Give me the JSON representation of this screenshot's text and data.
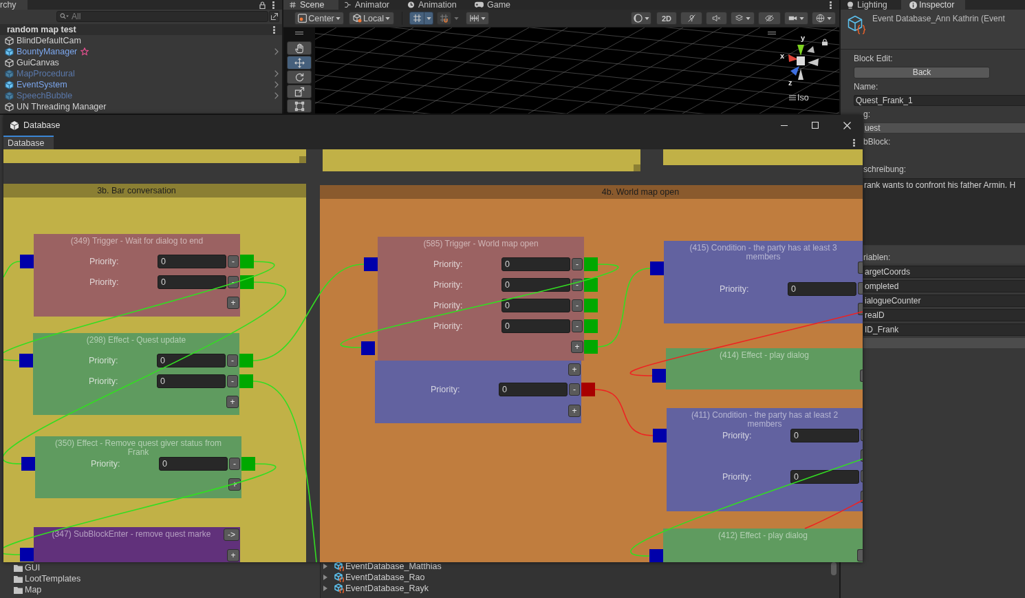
{
  "hierarchy": {
    "tab": "rchy",
    "search": {
      "placeholder": "All"
    },
    "scene": "random map test",
    "items": [
      {
        "label": "BlindDefaultCam",
        "prefab": false,
        "active": true,
        "starred": false
      },
      {
        "label": "BountyManager",
        "prefab": true,
        "active": true,
        "starred": true
      },
      {
        "label": "GuiCanvas",
        "prefab": false,
        "active": true,
        "starred": false
      },
      {
        "label": "MapProcedural",
        "prefab": true,
        "active": false,
        "starred": false
      },
      {
        "label": "EventSystem",
        "prefab": true,
        "active": true,
        "starred": false
      },
      {
        "label": "SpeechBubble",
        "prefab": true,
        "active": false,
        "starred": false
      },
      {
        "label": "UN Threading Manager",
        "prefab": false,
        "active": true,
        "starred": false
      }
    ]
  },
  "scene_view": {
    "tabs": [
      {
        "label": "Scene",
        "selected": true
      },
      {
        "label": "Animator",
        "selected": false
      },
      {
        "label": "Animation",
        "selected": false
      },
      {
        "label": "Game",
        "selected": false
      }
    ],
    "toolbar": {
      "pivot": "Center",
      "space": "Local",
      "grid_snap": {
        "on": true
      },
      "view_2d": {
        "label": "2D",
        "on": false
      }
    },
    "tools": [
      {
        "selected": false
      },
      {
        "selected": true
      },
      {
        "selected": false
      },
      {
        "selected": false
      },
      {
        "selected": false
      }
    ],
    "gizmo": {
      "axes": [
        "y",
        "x",
        "z"
      ],
      "projection": "Iso"
    }
  },
  "inspector": {
    "tabs": [
      {
        "label": "Lighting",
        "selected": false
      },
      {
        "label": "Inspector",
        "selected": true
      }
    ],
    "title": "Event Database_Ann Kathrin (Event",
    "block_edit_label": "Block Edit:",
    "back_button": "Back",
    "name_label": "Name:",
    "name_value": "Quest_Frank_1",
    "tag_label": "g:",
    "tag_value": "uest",
    "subblock_label": "bBlock:",
    "description_label": "schreibung:",
    "description": "rank wants to confront his father Armin. H",
    "variables_label": "riablen:",
    "variables": [
      "argetCoords",
      "ompleted",
      "ialogueCounter",
      "realD",
      "ID_Frank"
    ]
  },
  "database_window": {
    "title": "Database",
    "tabs": [
      {
        "label": "Database",
        "selected": true
      }
    ],
    "groups": [
      {
        "color": "#c1b147"
      },
      {
        "color": "#c1b147"
      },
      {
        "color": "#c1b147"
      },
      {
        "title": "3b. Bar conversation",
        "color": "#c1b147",
        "nodes": [
          {
            "title": "(349) Trigger - Wait for dialog to end",
            "kind": "trigger",
            "items": [
              {
                "kind": "row",
                "label": "Priority:",
                "value": "0",
                "remove": "-",
                "color": "#00a800"
              },
              {
                "kind": "row",
                "label": "Priority:",
                "value": "0",
                "remove": "-",
                "color": "#00a800"
              },
              {
                "kind": "add",
                "label": "+"
              }
            ]
          },
          {
            "title": "(298) Effect - Quest update",
            "kind": "effect",
            "items": [
              {
                "kind": "row",
                "label": "Priority:",
                "value": "0",
                "remove": "-",
                "color": "#00a800"
              },
              {
                "kind": "row",
                "label": "Priority:",
                "value": "0",
                "remove": "-",
                "color": "#00a800"
              },
              {
                "kind": "add",
                "label": "+"
              }
            ]
          },
          {
            "title": "(350) Effect - Remove quest giver status from Frank",
            "kind": "effect",
            "items": [
              {
                "kind": "row",
                "label": "Priority:",
                "value": "0",
                "remove": "-",
                "color": "#00a800"
              },
              {
                "kind": "add",
                "label": "+"
              }
            ]
          },
          {
            "title": "(347) SubBlockEnter - remove quest marke",
            "kind": "subblock",
            "enter_button": "->",
            "items": [
              {
                "kind": "add",
                "label": "+"
              }
            ]
          }
        ]
      },
      {
        "title": "4b. World map open",
        "color": "#c07d3e",
        "nodes": [
          {
            "title": "(585) Trigger - World map open",
            "kind": "trigger",
            "items": [
              {
                "kind": "row",
                "label": "Priority:",
                "value": "0",
                "remove": "-",
                "color": "#00a800"
              },
              {
                "kind": "row",
                "label": "Priority:",
                "value": "0",
                "remove": "-",
                "color": "#00a800"
              },
              {
                "kind": "row",
                "label": "Priority:",
                "value": "0",
                "remove": "-",
                "color": "#00a800"
              },
              {
                "kind": "row",
                "label": "Priority:",
                "value": "0",
                "remove": "-",
                "color": "#00a800"
              },
              {
                "kind": "add",
                "label": "+",
                "color": "#00a800"
              }
            ]
          },
          {
            "kind": "condition",
            "items": [
              {
                "kind": "add",
                "label": "+"
              },
              {
                "kind": "row",
                "label": "Priority:",
                "value": "0",
                "remove": "-",
                "color": "#a80000"
              },
              {
                "kind": "add",
                "label": "+"
              }
            ]
          },
          {
            "title": "(415) Condition - the party has at least 3 members",
            "kind": "condition",
            "items": [
              {
                "kind": "row",
                "label": "Priority:",
                "value": "0"
              }
            ]
          },
          {
            "title": "(414) Effect - play dialog",
            "kind": "effect"
          },
          {
            "title": "(411) Condition - the party has at least 2 members",
            "kind": "condition",
            "items": [
              {
                "kind": "row",
                "label": "Priority:",
                "value": "0"
              },
              {
                "kind": "row",
                "label": "Priority:",
                "value": "0"
              }
            ]
          },
          {
            "title": "(412) Effect - play dialog",
            "kind": "effect"
          }
        ]
      }
    ],
    "connections": [
      {
        "color": "#33dd22"
      },
      {
        "color": "#33dd22"
      },
      {
        "color": "#33dd22"
      },
      {
        "color": "#33dd22"
      },
      {
        "color": "#33dd22"
      },
      {
        "color": "#33dd22"
      },
      {
        "color": "#33dd22"
      },
      {
        "color": "#33dd22"
      },
      {
        "color": "#ee2222"
      },
      {
        "color": "#ee2222"
      },
      {
        "color": "#33dd22"
      },
      {
        "color": "#ee2222"
      }
    ]
  },
  "project": {
    "folders": [
      "GUI",
      "LootTemplates",
      "Map"
    ],
    "assets": [
      "EventDatabase_Matthias",
      "EventDatabase_Rao",
      "EventDatabase_Rayk"
    ]
  }
}
